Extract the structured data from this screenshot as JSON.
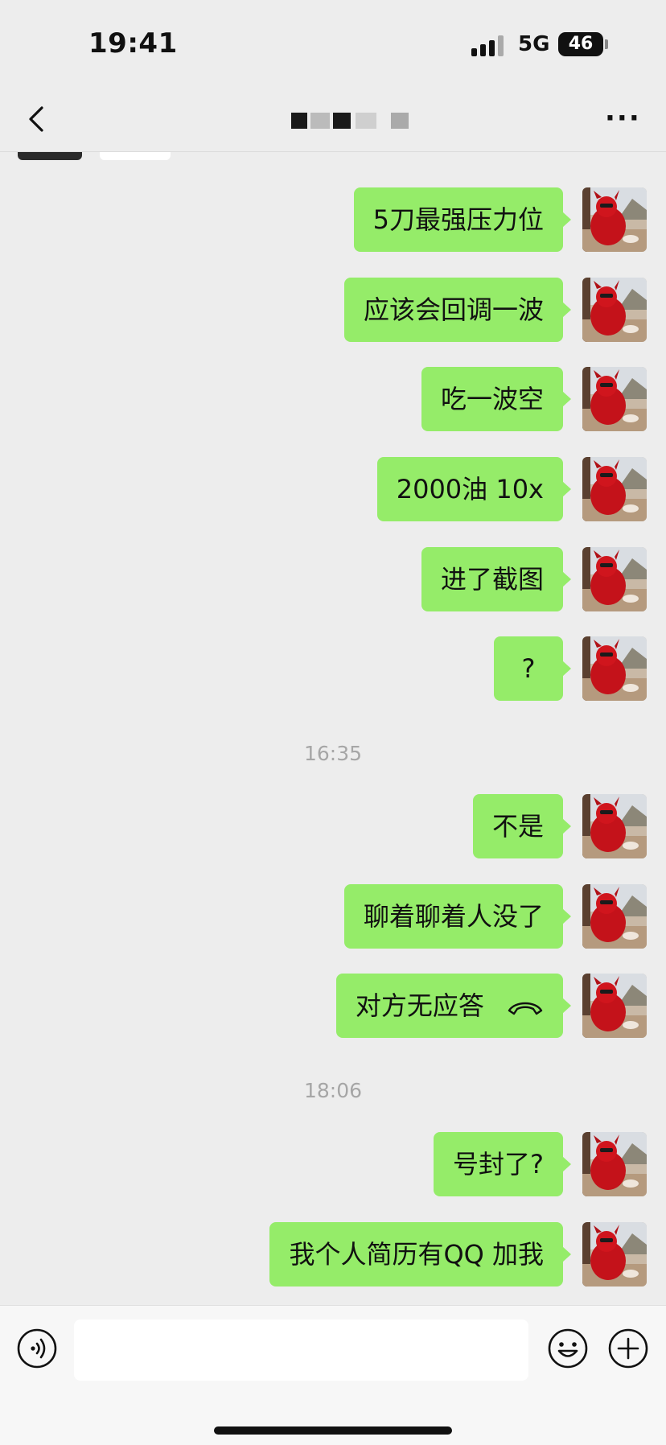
{
  "status_bar": {
    "time": "19:41",
    "network": "5G",
    "battery": "46"
  },
  "nav": {
    "title": "",
    "more_label": "···"
  },
  "messages": [
    {
      "type": "sent",
      "text": "5刀最强压力位"
    },
    {
      "type": "sent",
      "text": "应该会回调一波"
    },
    {
      "type": "sent",
      "text": "吃一波空"
    },
    {
      "type": "sent",
      "text": "2000油 10x"
    },
    {
      "type": "sent",
      "text": "进了截图"
    },
    {
      "type": "sent",
      "text": "?"
    },
    {
      "type": "time",
      "text": "16:35"
    },
    {
      "type": "sent",
      "text": "不是"
    },
    {
      "type": "sent",
      "text": "聊着聊着人没了"
    },
    {
      "type": "sent_call",
      "text": "对方无应答",
      "icon": "hang-up-icon"
    },
    {
      "type": "time",
      "text": "18:06"
    },
    {
      "type": "sent",
      "text": "号封了?"
    },
    {
      "type": "sent",
      "text": "我个人简历有QQ 加我"
    }
  ],
  "input_bar": {
    "text": "",
    "icons": [
      "voice-icon",
      "emoji-icon",
      "plus-icon"
    ]
  },
  "colors": {
    "background": "#ededed",
    "bubble_sent": "#95ec69",
    "timestamp": "#a6a6a6"
  }
}
